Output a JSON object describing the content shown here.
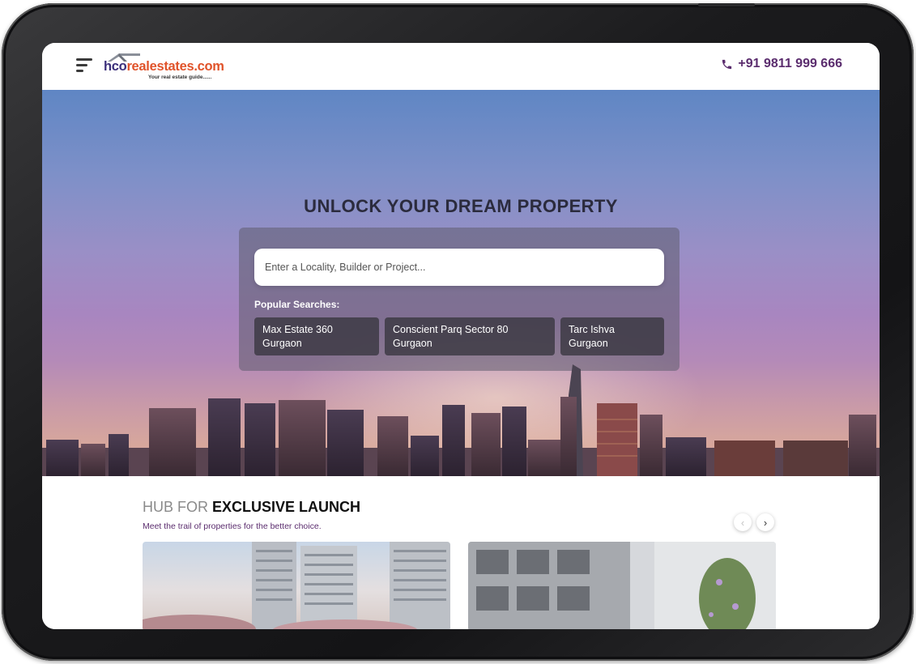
{
  "header": {
    "logo_name_part1": "hco",
    "logo_name_part2": "realestates.com",
    "logo_tagline": "Your real estate guide......",
    "phone": "+91 9811 999 666"
  },
  "hero": {
    "title": "UNLOCK YOUR DREAM PROPERTY",
    "search_placeholder": "Enter a Locality, Builder or Project...",
    "popular_label": "Popular Searches:",
    "popular_searches": [
      {
        "line1": "Max Estate 360",
        "line2": "Gurgaon"
      },
      {
        "line1": "Conscient Parq Sector 80",
        "line2": "Gurgaon"
      },
      {
        "line1": "Tarc Ishva",
        "line2": "Gurgaon"
      }
    ]
  },
  "section": {
    "title_light": "HUB FOR",
    "title_bold": "EXCLUSIVE LAUNCH",
    "subtitle": "Meet the trail of properties for the better choice.",
    "prev_icon": "chevron-left-icon",
    "next_icon": "chevron-right-icon"
  },
  "colors": {
    "brand_purple": "#5b2d6e",
    "logo_navy": "#3b2f7a",
    "logo_orange": "#e0532a"
  }
}
